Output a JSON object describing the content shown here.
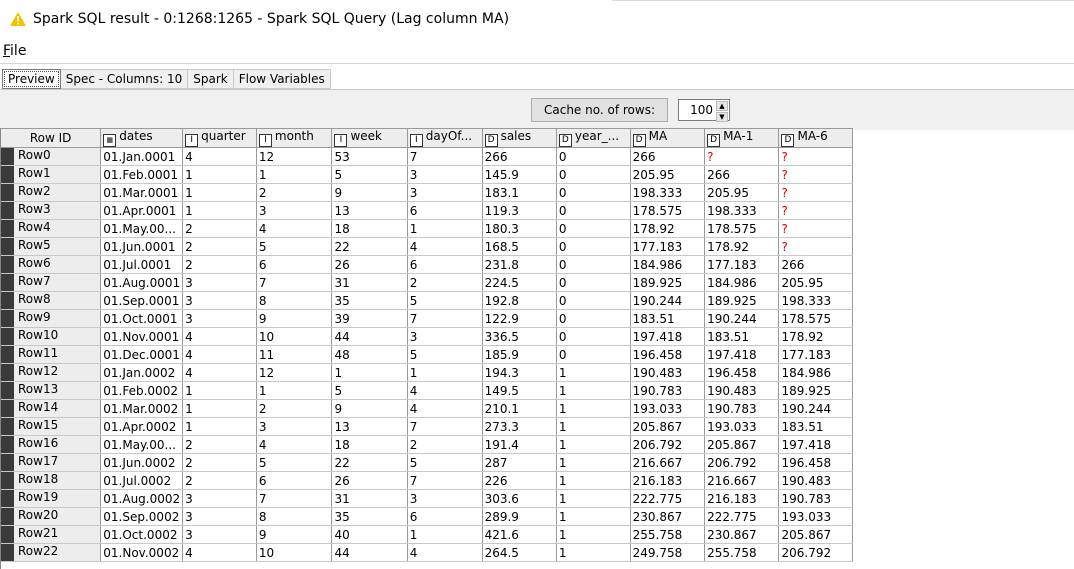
{
  "window": {
    "title": "Spark SQL result - 0:1268:1265 - Spark SQL Query (Lag column MA)"
  },
  "menu": {
    "file_label": "File",
    "file_underline": "F",
    "file_rest": "ile"
  },
  "tabs": [
    "Preview",
    "Spec - Columns: 10",
    "Spark",
    "Flow Variables"
  ],
  "cache": {
    "button_label": "Cache no. of rows:",
    "value": "100"
  },
  "table": {
    "columns": [
      {
        "type": "",
        "label": "Row ID"
      },
      {
        "type": "cal",
        "label": "dates"
      },
      {
        "type": "I",
        "label": "quarter"
      },
      {
        "type": "I",
        "label": "month"
      },
      {
        "type": "I",
        "label": "week"
      },
      {
        "type": "I",
        "label": "dayOf..."
      },
      {
        "type": "D",
        "label": "sales"
      },
      {
        "type": "D",
        "label": "year_..."
      },
      {
        "type": "D",
        "label": "MA"
      },
      {
        "type": "D",
        "label": "MA-1"
      },
      {
        "type": "D",
        "label": "MA-6"
      }
    ],
    "rows": [
      [
        "Row0",
        "01.Jan.0001",
        "4",
        "12",
        "53",
        "7",
        "266",
        "0",
        "266",
        "?",
        "?"
      ],
      [
        "Row1",
        "01.Feb.0001",
        "1",
        "1",
        "5",
        "3",
        "145.9",
        "0",
        "205.95",
        "266",
        "?"
      ],
      [
        "Row2",
        "01.Mar.0001",
        "1",
        "2",
        "9",
        "3",
        "183.1",
        "0",
        "198.333",
        "205.95",
        "?"
      ],
      [
        "Row3",
        "01.Apr.0001",
        "1",
        "3",
        "13",
        "6",
        "119.3",
        "0",
        "178.575",
        "198.333",
        "?"
      ],
      [
        "Row4",
        "01.May.00...",
        "2",
        "4",
        "18",
        "1",
        "180.3",
        "0",
        "178.92",
        "178.575",
        "?"
      ],
      [
        "Row5",
        "01.Jun.0001",
        "2",
        "5",
        "22",
        "4",
        "168.5",
        "0",
        "177.183",
        "178.92",
        "?"
      ],
      [
        "Row6",
        "01.Jul.0001",
        "2",
        "6",
        "26",
        "6",
        "231.8",
        "0",
        "184.986",
        "177.183",
        "266"
      ],
      [
        "Row7",
        "01.Aug.0001",
        "3",
        "7",
        "31",
        "2",
        "224.5",
        "0",
        "189.925",
        "184.986",
        "205.95"
      ],
      [
        "Row8",
        "01.Sep.0001",
        "3",
        "8",
        "35",
        "5",
        "192.8",
        "0",
        "190.244",
        "189.925",
        "198.333"
      ],
      [
        "Row9",
        "01.Oct.0001",
        "3",
        "9",
        "39",
        "7",
        "122.9",
        "0",
        "183.51",
        "190.244",
        "178.575"
      ],
      [
        "Row10",
        "01.Nov.0001",
        "4",
        "10",
        "44",
        "3",
        "336.5",
        "0",
        "197.418",
        "183.51",
        "178.92"
      ],
      [
        "Row11",
        "01.Dec.0001",
        "4",
        "11",
        "48",
        "5",
        "185.9",
        "0",
        "196.458",
        "197.418",
        "177.183"
      ],
      [
        "Row12",
        "01.Jan.0002",
        "4",
        "12",
        "1",
        "1",
        "194.3",
        "1",
        "190.483",
        "196.458",
        "184.986"
      ],
      [
        "Row13",
        "01.Feb.0002",
        "1",
        "1",
        "5",
        "4",
        "149.5",
        "1",
        "190.783",
        "190.483",
        "189.925"
      ],
      [
        "Row14",
        "01.Mar.0002",
        "1",
        "2",
        "9",
        "4",
        "210.1",
        "1",
        "193.033",
        "190.783",
        "190.244"
      ],
      [
        "Row15",
        "01.Apr.0002",
        "1",
        "3",
        "13",
        "7",
        "273.3",
        "1",
        "205.867",
        "193.033",
        "183.51"
      ],
      [
        "Row16",
        "01.May.00...",
        "2",
        "4",
        "18",
        "2",
        "191.4",
        "1",
        "206.792",
        "205.867",
        "197.418"
      ],
      [
        "Row17",
        "01.Jun.0002",
        "2",
        "5",
        "22",
        "5",
        "287",
        "1",
        "216.667",
        "206.792",
        "196.458"
      ],
      [
        "Row18",
        "01.Jul.0002",
        "2",
        "6",
        "26",
        "7",
        "226",
        "1",
        "216.183",
        "216.667",
        "190.483"
      ],
      [
        "Row19",
        "01.Aug.0002",
        "3",
        "7",
        "31",
        "3",
        "303.6",
        "1",
        "222.775",
        "216.183",
        "190.783"
      ],
      [
        "Row20",
        "01.Sep.0002",
        "3",
        "8",
        "35",
        "6",
        "289.9",
        "1",
        "230.867",
        "222.775",
        "193.033"
      ],
      [
        "Row21",
        "01.Oct.0002",
        "3",
        "9",
        "40",
        "1",
        "421.6",
        "1",
        "255.758",
        "230.867",
        "205.867"
      ],
      [
        "Row22",
        "01.Nov.0002",
        "4",
        "10",
        "44",
        "4",
        "264.5",
        "1",
        "249.758",
        "255.758",
        "206.792"
      ]
    ]
  },
  "colors": {
    "warning": "#f2c200",
    "missing": "#e00000",
    "row_marker": "#3a3a3a"
  },
  "icons": {
    "title": "warning-icon",
    "dates_column": "calendar-icon"
  }
}
